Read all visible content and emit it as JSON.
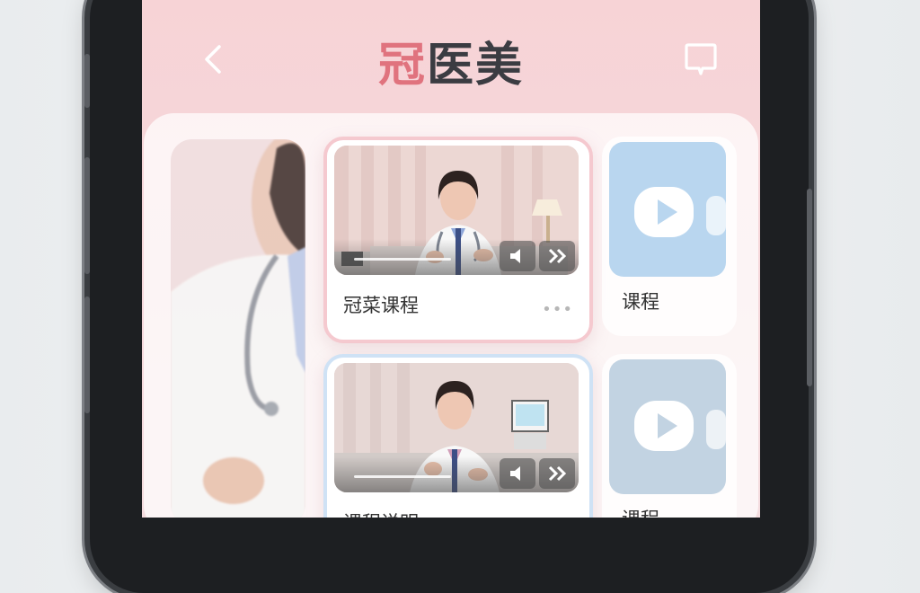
{
  "app": {
    "title_accent": "冠",
    "title_rest": "医美"
  },
  "cards": [
    {
      "label": "冠菜课程",
      "more": "•••"
    },
    {
      "label": "课程说明",
      "more": "•••"
    }
  ],
  "mini_cards": [
    {
      "label": "课程"
    },
    {
      "label": "课程"
    }
  ],
  "icons": {
    "back": "chevron-left-icon",
    "bookmark": "bookmark-icon",
    "play": "play-icon",
    "volume": "volume-icon",
    "forward": "fast-forward-icon"
  },
  "colors": {
    "accent": "#e0737e",
    "header_bg": "#f7d3d6",
    "mini_card_blue": "#b9d6ef"
  }
}
